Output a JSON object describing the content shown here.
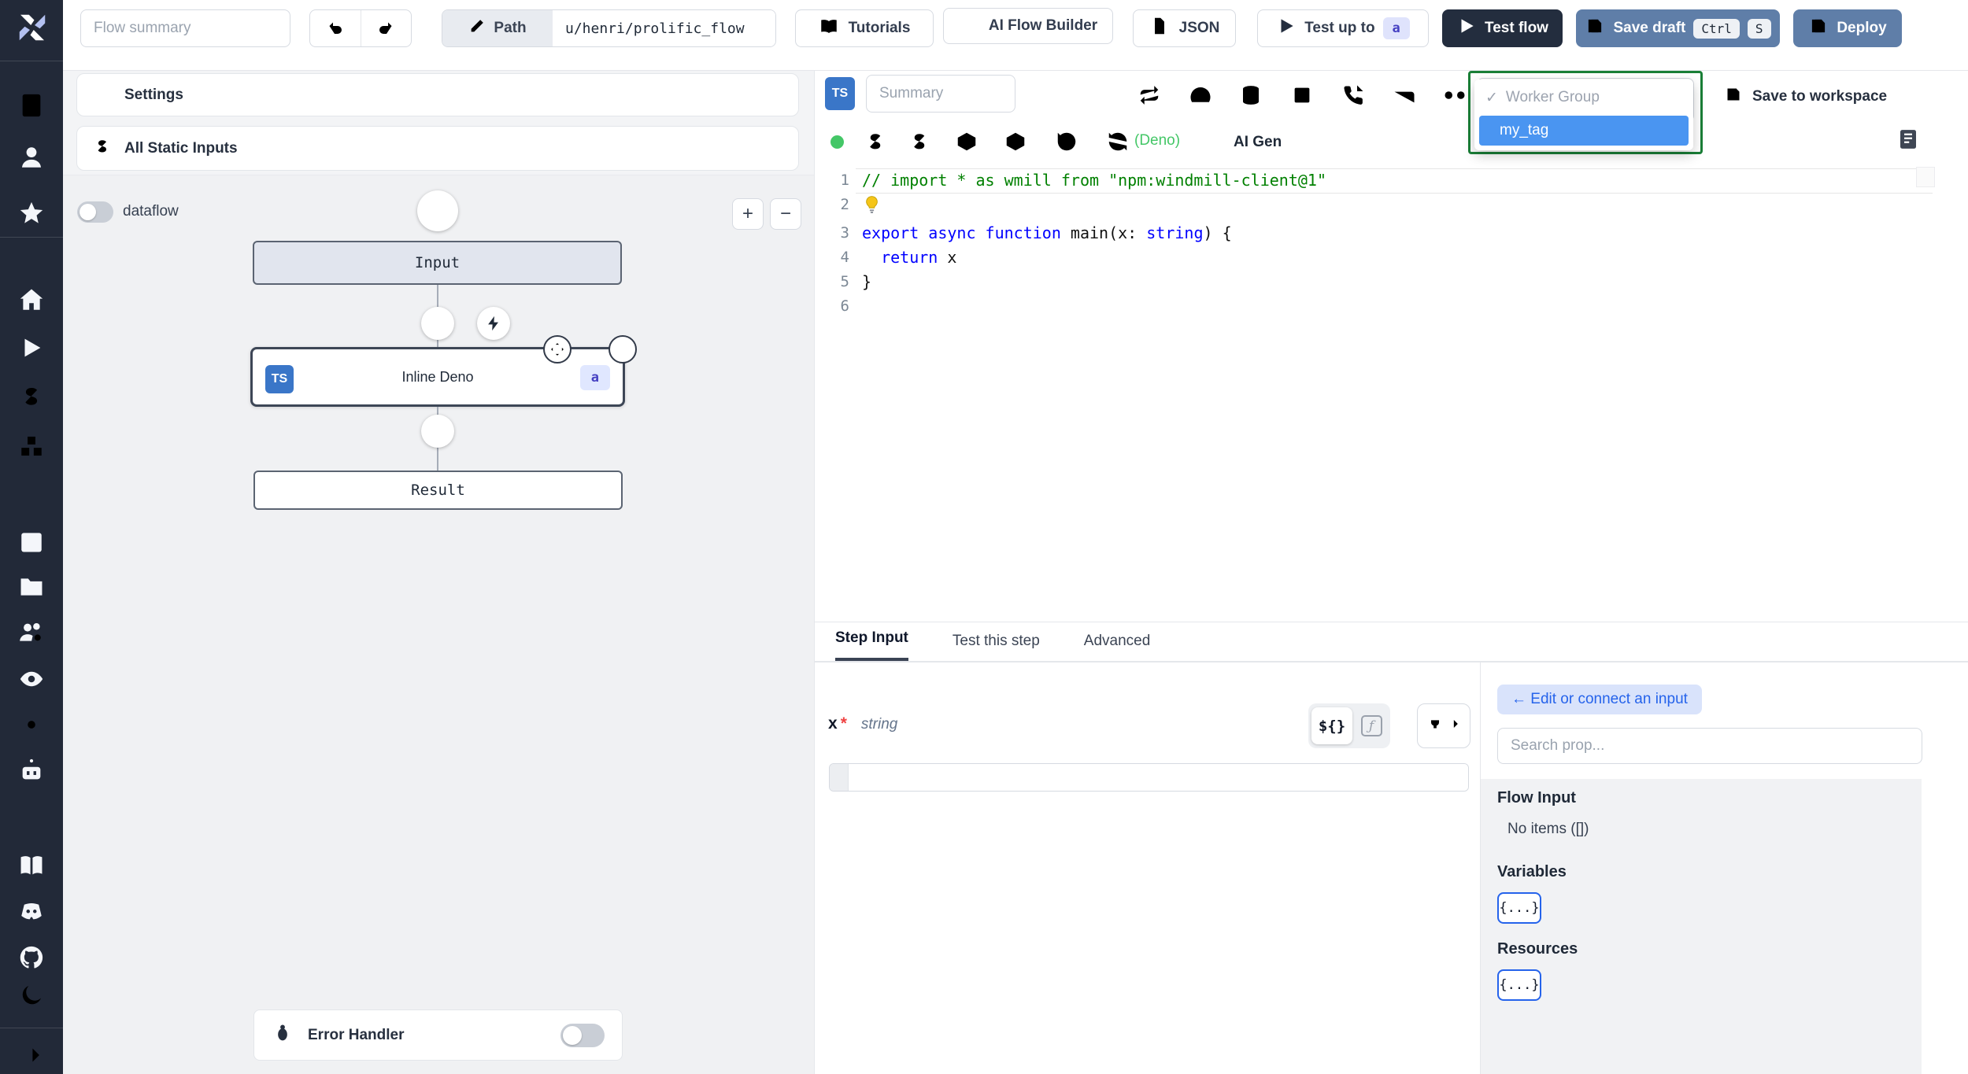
{
  "topbar": {
    "flow_summary_placeholder": "Flow summary",
    "path_label": "Path",
    "path_value": "u/henri/prolific_flow",
    "tutorials": "Tutorials",
    "ai_flow_builder": "AI Flow Builder",
    "json": "JSON",
    "test_up_to": "Test up to",
    "test_up_to_badge": "a",
    "test_flow": "Test flow",
    "save_draft": "Save draft",
    "kbd_ctrl": "Ctrl",
    "kbd_s": "S",
    "deploy": "Deploy"
  },
  "sidebar": {
    "icons": [
      "windmill-logo",
      "calculator",
      "user",
      "star",
      "home",
      "play",
      "dollar-sign",
      "boxes",
      "calendar",
      "folder-open",
      "users-settings",
      "eye",
      "settings-gear",
      "bot",
      "book-open",
      "discord",
      "github",
      "moon",
      "collapse-arrow-right"
    ]
  },
  "left_panel": {
    "settings": "Settings",
    "all_static_inputs": "All Static Inputs",
    "dataflow": "dataflow",
    "zoom_in": "+",
    "zoom_out": "−",
    "error_handler": "Error Handler"
  },
  "graph": {
    "input_node": "Input",
    "step_lang_badge": "TS",
    "step_node": "Inline Deno",
    "step_badge": "a",
    "result_node": "Result"
  },
  "editor": {
    "lang_badge": "TS",
    "summary_placeholder": "Summary",
    "toolbar_icons": [
      "repeat",
      "gauge",
      "database",
      "square",
      "phone-incoming",
      "bed",
      "voicemail"
    ],
    "worker_group_check": "✓",
    "worker_group_label": "Worker Group",
    "worker_group_selected": "my_tag",
    "save_to_workspace": "Save to workspace",
    "lang_note": "(Deno)",
    "ai_gen": "AI Gen",
    "line_numbers": [
      "1",
      "2",
      "3",
      "4",
      "5",
      "6"
    ],
    "code": {
      "l1": "// import * as wmill from \"npm:windmill-client@1\"",
      "l3_kw": "export async function ",
      "l3_fn": "main",
      "l3_p1": "(x: ",
      "l3_type": "string",
      "l3_p2": ") {",
      "l4_ind": "  ",
      "l4_kw": "return",
      "l4_rest": " x",
      "l5": "}"
    }
  },
  "step_panel": {
    "tabs": [
      "Step Input",
      "Test this step",
      "Advanced"
    ],
    "arg_name": "x",
    "arg_required": "*",
    "arg_type": "string",
    "template_toggle": "${}",
    "fx_glyph": "ƒ",
    "edit_or_connect": "← Edit or connect an input",
    "search_placeholder": "Search prop...",
    "flow_input_title": "Flow Input",
    "flow_input_empty": "No items ([])",
    "variables_title": "Variables",
    "resources_title": "Resources",
    "braces": "{...}"
  },
  "colors": {
    "sidebar_bg": "#222938",
    "primary_button": "#5f7ea8",
    "dark_button": "#232d3e",
    "ts_badge": "#3a76c8",
    "selected_option": "#4a95f1",
    "dropdown_border_green": "#1a7f37",
    "deno_green": "#44c767",
    "accent_blue": "#2563eb"
  }
}
